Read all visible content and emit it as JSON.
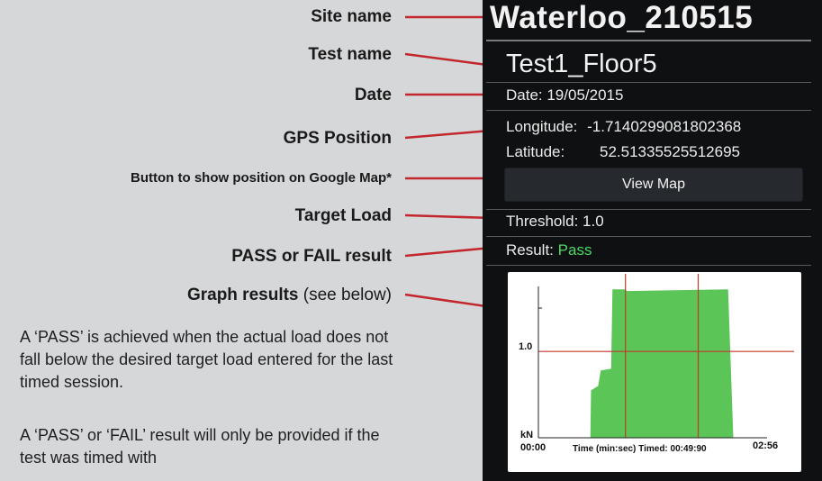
{
  "callouts": {
    "site_name": "Site name",
    "test_name": "Test name",
    "date": "Date",
    "gps": "GPS Position",
    "map_button": "Button to show position on Google Map*",
    "target_load": "Target Load",
    "result": "PASS or FAIL result",
    "graph_bold": "Graph results",
    "graph_rest": "(see below)"
  },
  "notes": {
    "pass_rule": "A ‘PASS’ is achieved when the actual load does not fall below the desired target load entered for the last timed session.",
    "pass_fail_rule": "A ‘PASS’ or ‘FAIL’ result will only be provided if the test was timed with"
  },
  "colors": {
    "leader": "#c1272d",
    "pass": "#4cd964",
    "graph_fill": "#5cc558",
    "graph_line": "#c0392b"
  },
  "phone": {
    "site_name": "Waterloo_210515",
    "test_name": "Test1_Floor5",
    "date": "Date: 19/05/2015",
    "longitude_label": "Longitude:",
    "longitude_value": "-1.7140299081802368",
    "latitude_label": "Latitude:",
    "latitude_value": "52.51335525512695",
    "view_map_label": "View Map",
    "threshold": "Threshold: 1.0",
    "result_label": "Result:",
    "result_value": "Pass"
  },
  "chart_data": {
    "type": "area",
    "xlabel": "Time (min:sec) Timed: 00:49:90",
    "ylabel": "kN",
    "x_tick_labels": [
      "00:00",
      "02:56"
    ],
    "y_tick_labels": [
      "1.0"
    ],
    "threshold": 1.0,
    "xlim": [
      0,
      176
    ],
    "ylim": [
      0,
      1.9
    ],
    "x": [
      0,
      40,
      40.5,
      46,
      48,
      56,
      57,
      67,
      68,
      146,
      150,
      176
    ],
    "y": [
      0,
      0,
      0.55,
      0.6,
      0.78,
      0.8,
      1.72,
      1.72,
      1.7,
      1.72,
      0,
      0
    ],
    "vertical_markers": [
      67,
      123
    ]
  }
}
